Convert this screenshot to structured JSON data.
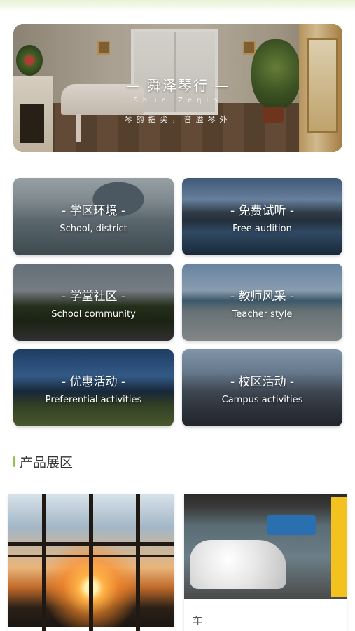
{
  "banner": {
    "title": "— 舜泽琴行 —",
    "subtitle": "Shun Zeqin",
    "slogan": "琴韵指尖，音溢琴外",
    "active_dot": 1
  },
  "categories": [
    {
      "id": "school",
      "title": "- 学区环境 -",
      "subtitle": "School, district"
    },
    {
      "id": "audition",
      "title": "- 免费试听 -",
      "subtitle": "Free audition"
    },
    {
      "id": "community",
      "title": "- 学堂社区 -",
      "subtitle": "School community"
    },
    {
      "id": "teacher",
      "title": "- 教师风采 -",
      "subtitle": "Teacher style"
    },
    {
      "id": "offers",
      "title": "- 优惠活动 -",
      "subtitle": "Preferential activities"
    },
    {
      "id": "campus",
      "title": "- 校区活动 -",
      "subtitle": "Campus activities"
    }
  ],
  "products_section": {
    "title": "产品展区",
    "accent_color": "#8fc44a",
    "items": [
      {
        "caption": ""
      },
      {
        "caption": "车"
      }
    ]
  }
}
